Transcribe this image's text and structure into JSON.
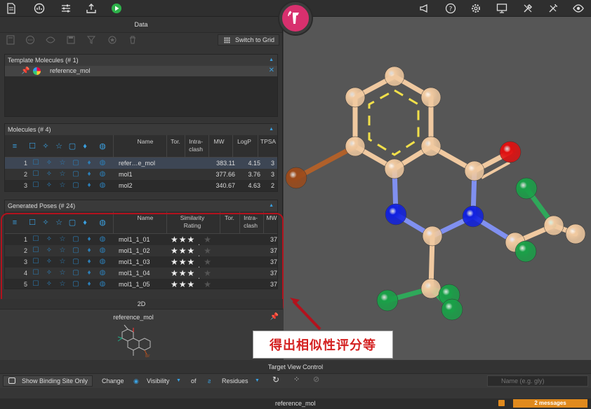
{
  "data_panel": {
    "title": "Data",
    "switch_grid_label": "Switch to Grid"
  },
  "template_molecules": {
    "title": "Template Molecules",
    "count": "(# 1)",
    "items": [
      {
        "name": "reference_mol"
      }
    ]
  },
  "molecules": {
    "title": "Molecules",
    "count": "(# 4)",
    "columns": [
      "Name",
      "Tor.",
      "Intra-\nclash",
      "MW",
      "LogP",
      "TPSA"
    ],
    "rows": [
      {
        "idx": "1",
        "name": "refer…e_mol",
        "mw": "383.11",
        "logp": "4.15",
        "tpsa": "3"
      },
      {
        "idx": "2",
        "name": "mol1",
        "mw": "377.66",
        "logp": "3.76",
        "tpsa": "3"
      },
      {
        "idx": "3",
        "name": "mol2",
        "mw": "340.67",
        "logp": "4.63",
        "tpsa": "2"
      }
    ]
  },
  "generated_poses": {
    "title": "Generated Poses",
    "count": "(# 24)",
    "columns": [
      "Name",
      "Similarity\nRating",
      "Tor.",
      "Intra-\nclash",
      "MW"
    ],
    "rows": [
      {
        "idx": "1",
        "name": "mol1_1_01",
        "rating": 3.5,
        "mw": "37"
      },
      {
        "idx": "2",
        "name": "mol1_1_02",
        "rating": 3.5,
        "mw": "37"
      },
      {
        "idx": "3",
        "name": "mol1_1_03",
        "rating": 3.5,
        "mw": "37"
      },
      {
        "idx": "4",
        "name": "mol1_1_04",
        "rating": 3.5,
        "mw": "37"
      },
      {
        "idx": "5",
        "name": "mol1_1_05",
        "rating": 3.5,
        "mw": "37"
      }
    ]
  },
  "panel_2d": {
    "title": "2D",
    "molecule_name": "reference_mol"
  },
  "annotation": {
    "text": "得出相似性评分等"
  },
  "target_view_control": {
    "title": "Target View Control",
    "show_binding_site_label": "Show Binding Site Only",
    "change_label": "Change",
    "visibility_label": "Visibility",
    "of_label": "of",
    "residues_label": "Residues",
    "search_placeholder": "Name (e.g. gly)"
  },
  "status_bar": {
    "current_molecule": "reference_mol",
    "messages": "2 messages"
  },
  "colors": {
    "accent_blue": "#3aa0e0",
    "brand_pink": "#d8306e",
    "highlight_red": "#b3121d",
    "warning_orange": "#e08a1e"
  }
}
